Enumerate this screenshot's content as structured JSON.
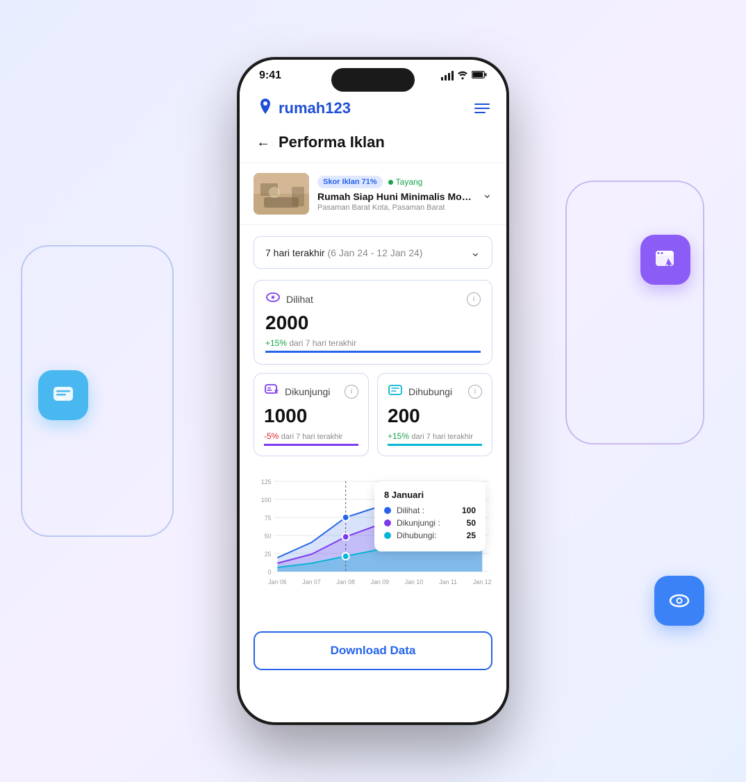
{
  "page": {
    "background": "#eef2ff"
  },
  "status_bar": {
    "time": "9:41",
    "signal": "signal",
    "wifi": "wifi",
    "battery": "battery"
  },
  "header": {
    "logo_text": "rumah123",
    "menu_icon": "menu"
  },
  "page_title": "Performa Iklan",
  "listing": {
    "score_badge": "Skor Iklan 71%",
    "status_badge": "Tayang",
    "title": "Rumah Siap Huni Minimalis Modern N...",
    "location": "Pasaman Barat Kota, Pasaman Barat"
  },
  "date_filter": {
    "label": "7 hari terakhir",
    "range": "(6 Jan 24 - 12 Jan 24)"
  },
  "stats": {
    "views": {
      "label": "Dilihat",
      "value": "2000",
      "change": "+15%",
      "change_label": "dari 7 hari terakhir",
      "positive": true
    },
    "visits": {
      "label": "Dikunjungi",
      "value": "1000",
      "change": "-5%",
      "change_label": "dari 7 hari terakhir",
      "positive": false
    },
    "contacts": {
      "label": "Dihubungi",
      "value": "200",
      "change": "+15%",
      "change_label": "dari 7 hari terakhir",
      "positive": true
    }
  },
  "chart": {
    "y_labels": [
      "0",
      "25",
      "50",
      "75",
      "100",
      "125"
    ],
    "x_labels": [
      "Jan 06",
      "Jan 07",
      "Jan 08",
      "Jan 09",
      "Jan 10",
      "Jan 11",
      "Jan 12"
    ],
    "tooltip": {
      "date": "8 Januari",
      "dilihat_label": "Dilihat :",
      "dilihat_value": "100",
      "dikunjungi_label": "Dikunjungi :",
      "dikunjungi_value": "50",
      "dihubungi_label": "Dihubungi:",
      "dihubungi_value": "25"
    }
  },
  "download_button": {
    "label": "Download Data"
  },
  "floating_icons": {
    "chat": "chat-bubble",
    "browser": "browser-cursor",
    "eye": "eye"
  }
}
